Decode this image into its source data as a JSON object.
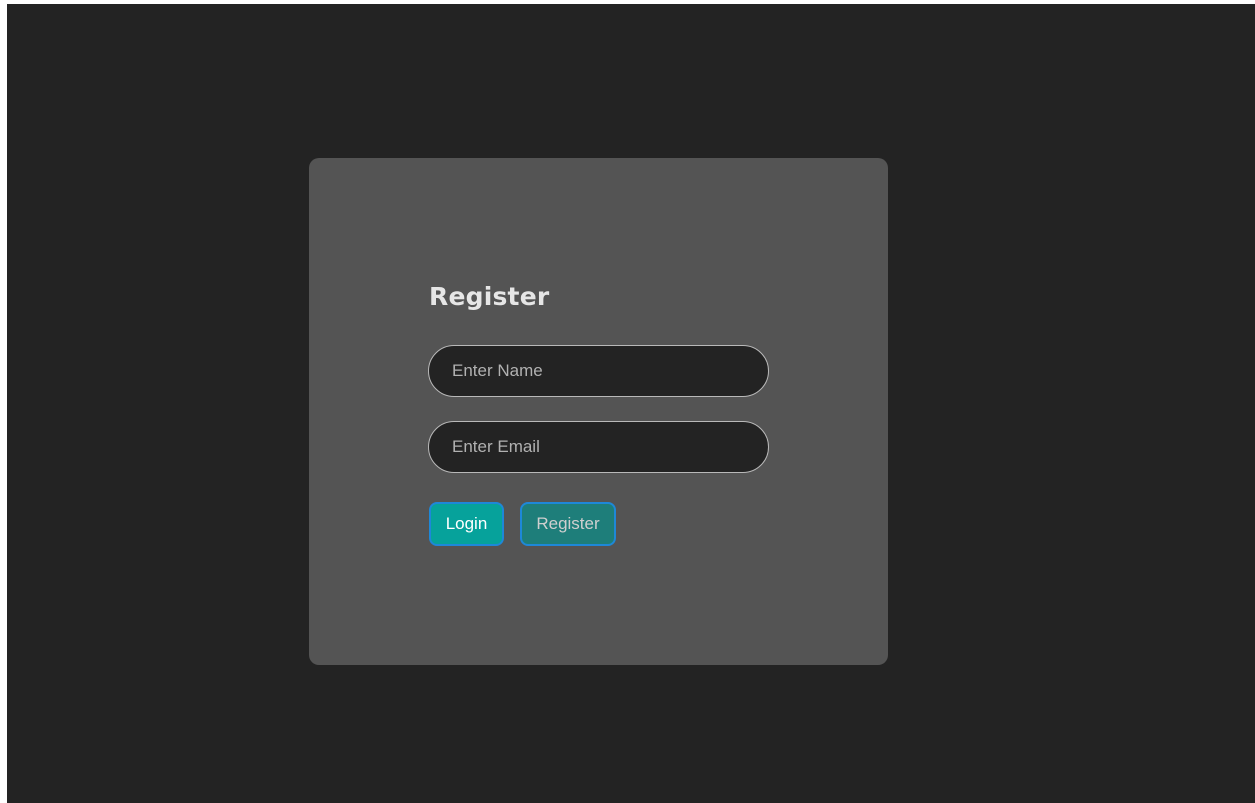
{
  "form": {
    "title": "Register",
    "name_field": {
      "placeholder": "Enter Name",
      "value": ""
    },
    "email_field": {
      "placeholder": "Enter Email",
      "value": ""
    },
    "login_button": "Login",
    "register_button": "Register"
  },
  "colors": {
    "page_background": "#232323",
    "card_background": "#545454",
    "login_button": "#06a29b",
    "register_button": "#1e7e7a",
    "button_border": "#1e88d8"
  }
}
